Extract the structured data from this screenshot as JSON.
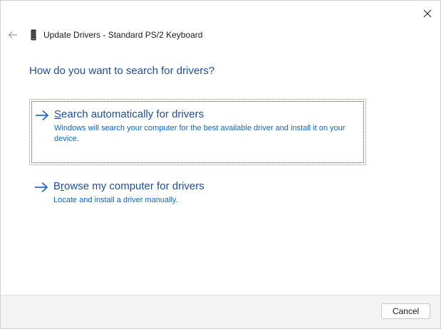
{
  "window": {
    "title": "Update Drivers - Standard PS/2 Keyboard",
    "icons": {
      "close": "close-icon",
      "back": "back-arrow-icon",
      "device": "keyboard-device-icon"
    }
  },
  "main": {
    "heading": "How do you want to search for drivers?",
    "options": [
      {
        "access_key": "S",
        "title_rest": "earch automatically for drivers",
        "description": "Windows will search your computer for the best available driver and install it on your device."
      },
      {
        "title_first": "B",
        "access_key": "r",
        "title_rest": "owse my computer for drivers",
        "description": "Locate and install a driver manually."
      }
    ]
  },
  "footer": {
    "cancel_label": "Cancel"
  },
  "colors": {
    "heading": "#1f4e96",
    "description": "#0b67c4",
    "arrow": "#1f6fc2",
    "footer_bg": "#f3f3f3"
  }
}
